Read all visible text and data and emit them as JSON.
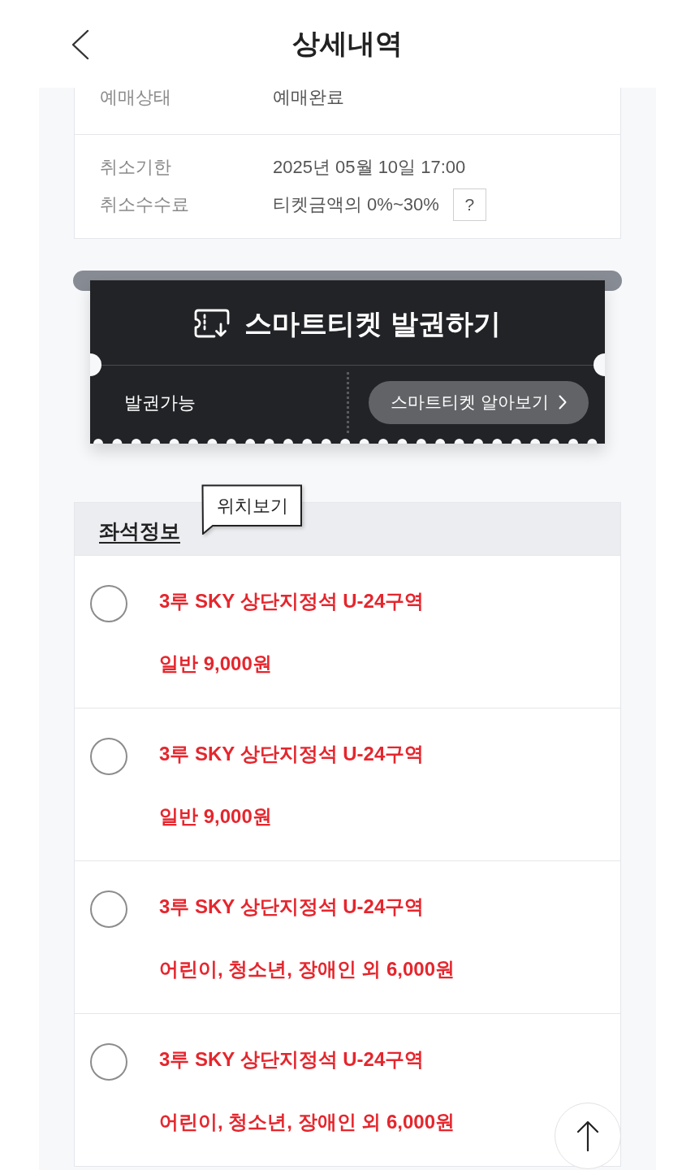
{
  "header": {
    "title": "상세내역"
  },
  "booking_info": {
    "groups": [
      {
        "rows": [
          {
            "label": "예매상태",
            "value": "예매완료"
          }
        ]
      },
      {
        "rows": [
          {
            "label": "취소기한",
            "value": "2025년 05월 10일 17:00"
          },
          {
            "label": "취소수수료",
            "value": "티켓금액의 0%~30%",
            "help": "?"
          }
        ]
      }
    ]
  },
  "smart_ticket": {
    "title": "스마트티켓 발권하기",
    "status": "발권가능",
    "guide_button": "스마트티켓 알아보기"
  },
  "seat_info": {
    "title": "좌석정보",
    "tooltip": "위치보기",
    "seats": [
      {
        "section": "3루 SKY 상단지정석 U-24구역",
        "price": "일반 9,000원",
        "selected": false
      },
      {
        "section": "3루 SKY 상단지정석 U-24구역",
        "price": "일반 9,000원",
        "selected": false
      },
      {
        "section": "3루 SKY 상단지정석 U-24구역",
        "price": "어린이, 청소년, 장애인 외 6,000원",
        "selected": false
      },
      {
        "section": "3루 SKY 상단지정석 U-24구역",
        "price": "어린이, 청소년, 장애인 외 6,000원",
        "selected": false
      }
    ]
  }
}
